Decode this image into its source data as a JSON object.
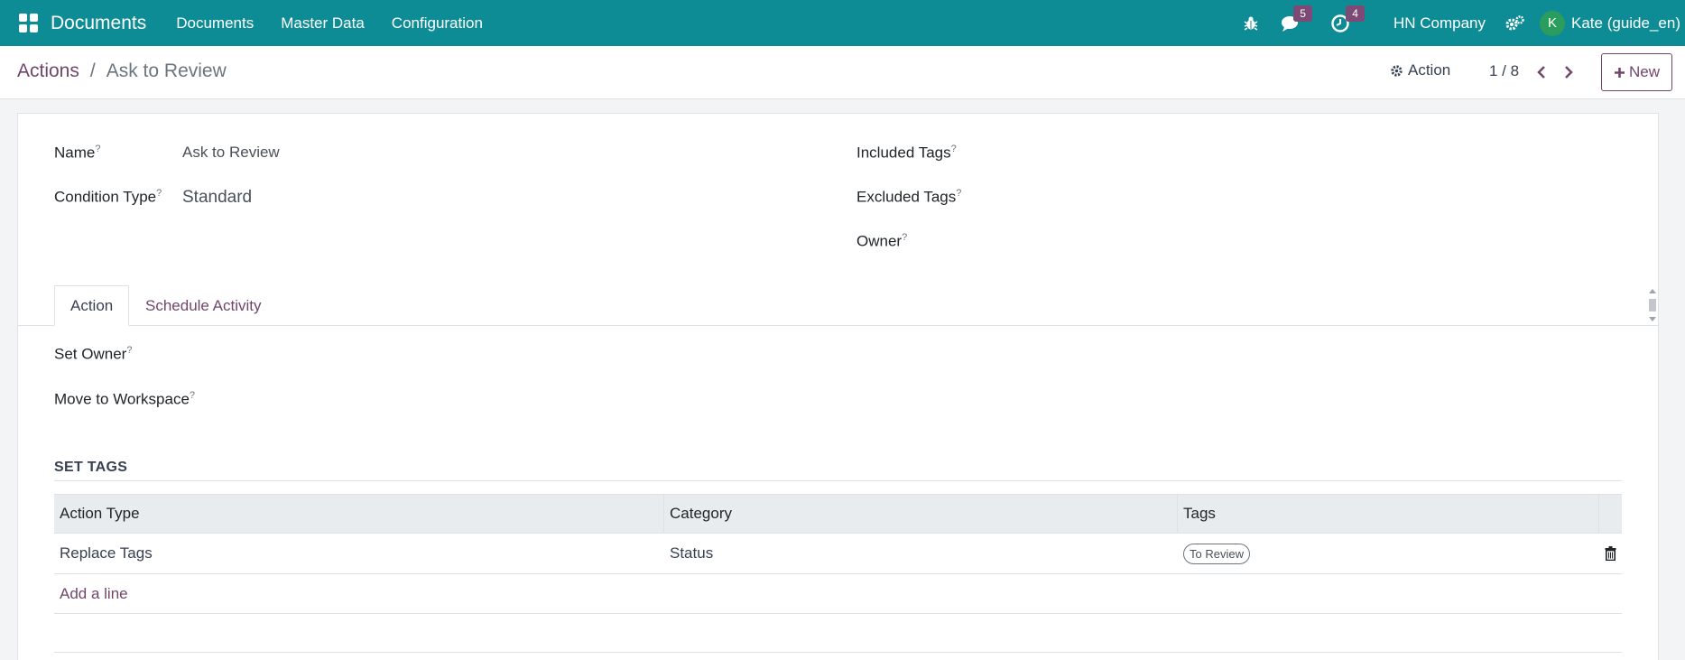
{
  "navbar": {
    "brand": "Documents",
    "menu": [
      "Documents",
      "Master Data",
      "Configuration"
    ],
    "messages_count": "5",
    "activities_count": "4",
    "company": "HN Company",
    "user_initial": "K",
    "user_name": "Kate (guide_en)"
  },
  "control": {
    "breadcrumb_parent": "Actions",
    "breadcrumb_sep": "/",
    "breadcrumb_current": "Ask to Review",
    "action_label": "Action",
    "pager": "1 / 8",
    "new_label": "New"
  },
  "form": {
    "name_label": "Name",
    "name_value": "Ask to Review",
    "condition_label": "Condition Type",
    "condition_value": "Standard",
    "included_tags_label": "Included Tags",
    "excluded_tags_label": "Excluded Tags",
    "owner_label": "Owner",
    "help_mark": "?"
  },
  "tabs": [
    "Action",
    "Schedule Activity"
  ],
  "action_tab": {
    "set_owner_label": "Set Owner",
    "move_workspace_label": "Move to Workspace",
    "set_tags_title": "SET TAGS",
    "columns": [
      "Action Type",
      "Category",
      "Tags"
    ],
    "rows": [
      {
        "action_type": "Replace Tags",
        "category": "Status",
        "tag": "To Review"
      }
    ],
    "add_line": "Add a line"
  },
  "colors": {
    "navbar": "#0e8c95",
    "accent": "#71466a",
    "badge": "#7c4a74",
    "avatar": "#2a9d5c"
  }
}
